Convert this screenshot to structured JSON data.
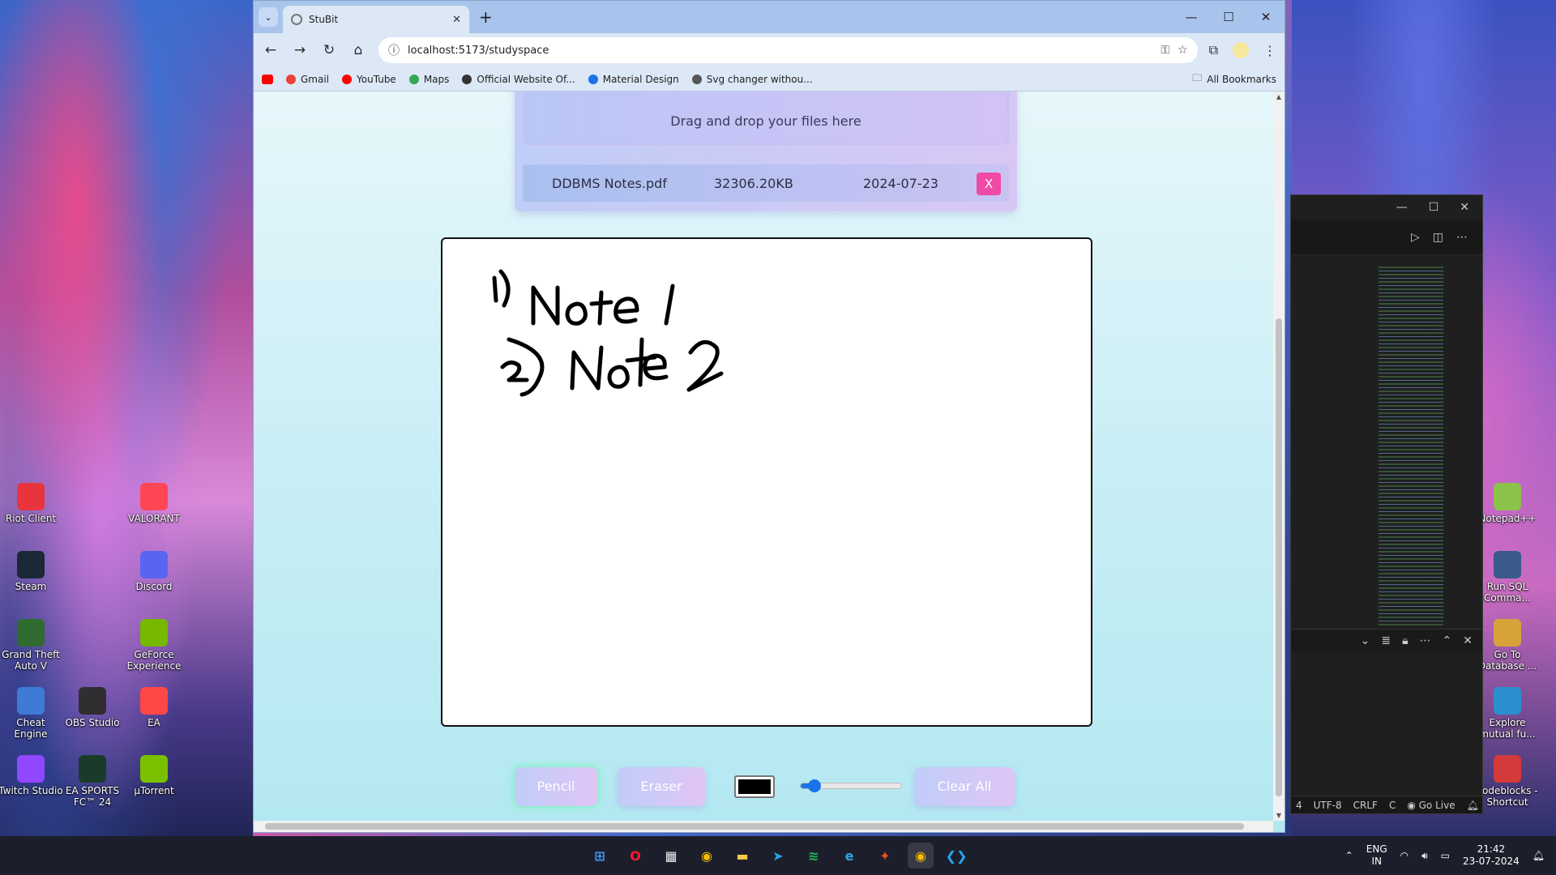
{
  "desktop": {
    "left_icons": [
      {
        "label": "Riot Client",
        "icon": "riot-icon",
        "color": "#e8343d"
      },
      {
        "label": "VALORANT",
        "icon": "valorant-icon",
        "color": "#ff4655"
      },
      {
        "label": "Steam",
        "icon": "steam-icon",
        "color": "#1b2838"
      },
      {
        "label": "Discord",
        "icon": "discord-icon",
        "color": "#5865f2"
      },
      {
        "label": "Grand Theft Auto V",
        "icon": "gta-icon",
        "color": "#2f6b2f"
      },
      {
        "label": "GeForce Experience",
        "icon": "geforce-icon",
        "color": "#76b900"
      },
      {
        "label": "Cheat Engine",
        "icon": "cheat-engine-icon",
        "color": "#3d7bd6"
      },
      {
        "label": "OBS Studio",
        "icon": "obs-icon",
        "color": "#302e31"
      },
      {
        "label": "EA",
        "icon": "ea-icon",
        "color": "#ff4747"
      },
      {
        "label": "Twitch Studio",
        "icon": "twitch-icon",
        "color": "#9146ff"
      },
      {
        "label": "EA SPORTS FC™ 24",
        "icon": "fc24-icon",
        "color": "#1a3b2a"
      },
      {
        "label": "µTorrent",
        "icon": "utorrent-icon",
        "color": "#78c000"
      }
    ],
    "right_icons": [
      {
        "label": "Notepad++",
        "icon": "notepadpp-icon",
        "color": "#8bc34a"
      },
      {
        "label": "Run SQL Comma...",
        "icon": "sql-icon",
        "color": "#3a5a8c"
      },
      {
        "label": "Go To Database ...",
        "icon": "database-icon",
        "color": "#d8a23a"
      },
      {
        "label": "Explore mutual fu...",
        "icon": "explore-icon",
        "color": "#2a8fcf"
      },
      {
        "label": "codeblocks - Shortcut",
        "icon": "codeblocks-icon",
        "color": "#d33a3a"
      }
    ]
  },
  "vscode": {
    "status": [
      "4",
      "UTF-8",
      "CRLF",
      "C",
      "Go Live"
    ]
  },
  "browser": {
    "tab_title": "StuBit",
    "url": "localhost:5173/studyspace",
    "bookmarks": [
      {
        "label": "Gmail",
        "icon": "gmail-icon",
        "color": "#ea4335"
      },
      {
        "label": "YouTube",
        "icon": "youtube-icon",
        "color": "#ff0000"
      },
      {
        "label": "Maps",
        "icon": "maps-icon",
        "color": "#34a853"
      },
      {
        "label": "Official Website Of...",
        "icon": "globe-icon",
        "color": "#333333"
      },
      {
        "label": "Material Design",
        "icon": "material-icon",
        "color": "#1a73e8"
      },
      {
        "label": "Svg changer withou...",
        "icon": "gear-icon",
        "color": "#555555"
      }
    ],
    "all_bookmarks": "All Bookmarks"
  },
  "page": {
    "dropzone_text": "Drag and drop your files here",
    "files": [
      {
        "name": "DDBMS Notes.pdf",
        "size": "32306.20KB",
        "date": "2024-07-23",
        "delete_label": "X"
      }
    ],
    "canvas_notes": [
      "1) Note 1",
      "2) Note 2"
    ],
    "controls": {
      "pencil": "Pencil",
      "eraser": "Eraser",
      "clear": "Clear All",
      "color": "#000000",
      "stroke_size_fraction": 0.1
    }
  },
  "taskbar": {
    "apps": [
      {
        "name": "windows-start-icon",
        "color": "#3aa0ff",
        "glyph": "⊞"
      },
      {
        "name": "opera-icon",
        "color": "#ff1b2d",
        "glyph": "O"
      },
      {
        "name": "store-icon",
        "color": "#f0f0f0",
        "glyph": "▦"
      },
      {
        "name": "chrome-icon",
        "color": "#fbbc05",
        "glyph": "◉"
      },
      {
        "name": "file-explorer-icon",
        "color": "#f7c948",
        "glyph": "▬"
      },
      {
        "name": "telegram-icon",
        "color": "#2aa3df",
        "glyph": "➤"
      },
      {
        "name": "spotify-icon",
        "color": "#1db954",
        "glyph": "≋"
      },
      {
        "name": "edge-icon",
        "color": "#2ca8e0",
        "glyph": "e"
      },
      {
        "name": "figma-icon",
        "color": "#f24e1e",
        "glyph": "✦"
      },
      {
        "name": "chrome-active-icon",
        "color": "#fbbc05",
        "glyph": "◉"
      },
      {
        "name": "vscode-icon",
        "color": "#23a9f2",
        "glyph": "❮❯"
      }
    ],
    "lang_line1": "ENG",
    "lang_line2": "IN",
    "time": "21:42",
    "date": "23-07-2024"
  }
}
